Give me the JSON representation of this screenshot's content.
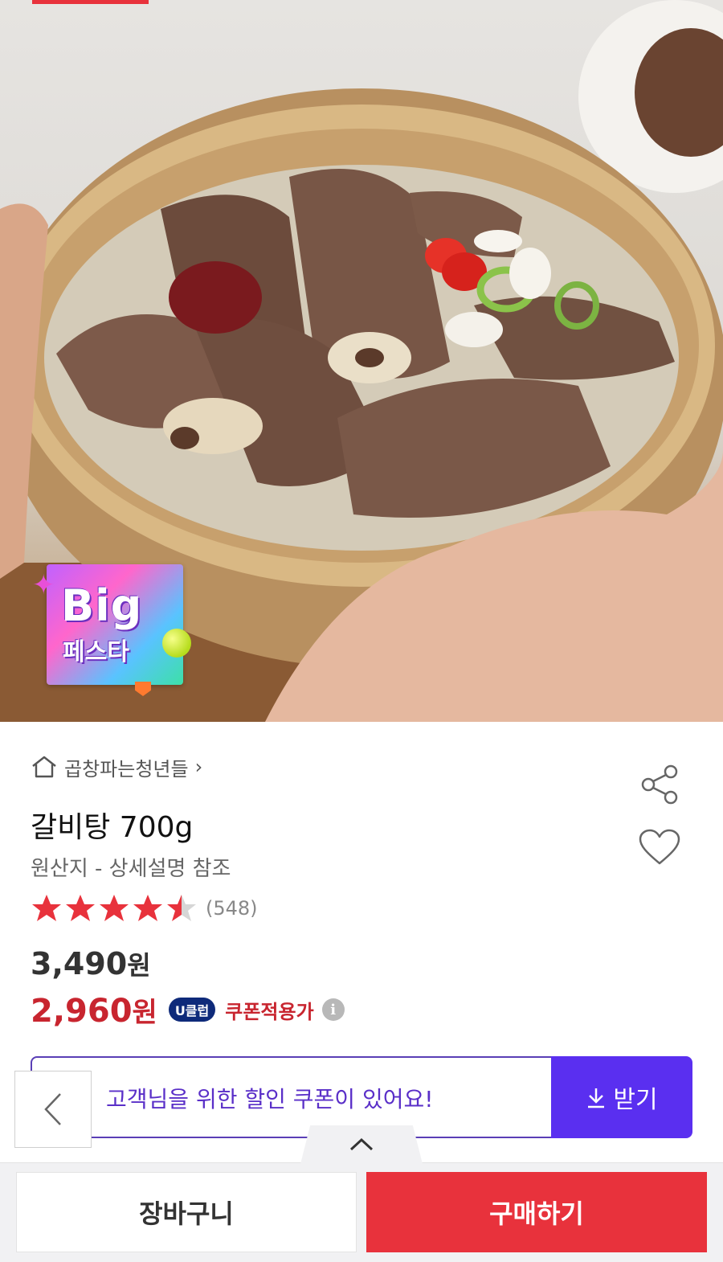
{
  "hero": {
    "badge_big": "Big",
    "badge_festa": "페스타"
  },
  "store": {
    "name": "곱창파는청년들",
    "chevron": "›"
  },
  "product": {
    "title": "갈비탕 700g",
    "origin": "원산지 - 상세설명 참조",
    "rating": 4.5,
    "rating_max": 5,
    "review_count": "(548)",
    "price_value": "3,490",
    "price_unit": "원",
    "sale_value": "2,960",
    "sale_unit": "원",
    "uclub_badge": "U클럽",
    "coupon_label": "쿠폰적용가",
    "info_icon": "i"
  },
  "coupon": {
    "text": "고객님을 위한 할인 쿠폰이 있어요!",
    "receive_label": "받기"
  },
  "bottom": {
    "cart_label": "장바구니",
    "buy_label": "구매하기"
  },
  "colors": {
    "accent_red": "#e8323c",
    "sale_red": "#c8252f",
    "coupon_purple": "#5a2ff0",
    "uclub_navy": "#0e2a7a"
  },
  "icons": [
    "home-icon",
    "share-icon",
    "heart-icon",
    "star-icon",
    "info-icon",
    "download-icon",
    "chevron-left-icon",
    "chevron-up-icon"
  ]
}
